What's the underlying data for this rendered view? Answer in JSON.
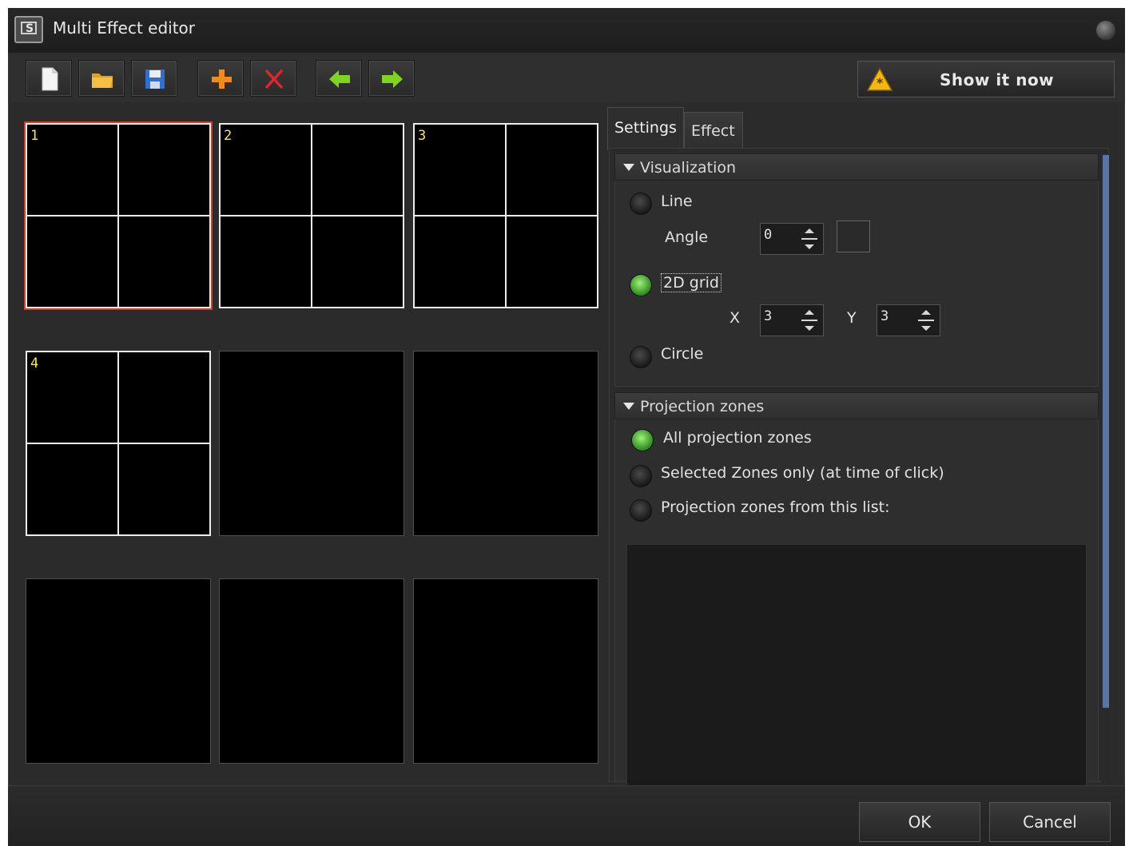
{
  "window": {
    "title": "Multi Effect editor"
  },
  "toolbar": {
    "buttons": [
      {
        "name": "new-file-button",
        "icon": "document-icon"
      },
      {
        "name": "open-folder-button",
        "icon": "folder-icon"
      },
      {
        "name": "save-button",
        "icon": "floppy-disk-icon"
      },
      {
        "name": "add-button",
        "icon": "plus-icon"
      },
      {
        "name": "delete-button",
        "icon": "x-icon"
      },
      {
        "name": "move-left-button",
        "icon": "arrow-left-icon"
      },
      {
        "name": "move-right-button",
        "icon": "arrow-right-icon"
      }
    ],
    "show_label": "Show it now"
  },
  "preview": {
    "cells": [
      {
        "label": "1",
        "grid": true,
        "selected": true
      },
      {
        "label": "2",
        "grid": true,
        "selected": false
      },
      {
        "label": "3",
        "grid": true,
        "selected": false
      },
      {
        "label": "4",
        "grid": true,
        "selected": false
      },
      {
        "label": "",
        "grid": false,
        "selected": false
      },
      {
        "label": "",
        "grid": false,
        "selected": false
      },
      {
        "label": "",
        "grid": false,
        "selected": false
      },
      {
        "label": "",
        "grid": false,
        "selected": false
      },
      {
        "label": "",
        "grid": false,
        "selected": false
      }
    ]
  },
  "tabs": {
    "settings": "Settings",
    "effect": "Effect",
    "active": "settings"
  },
  "visualization": {
    "header": "Visualization",
    "line_label": "Line",
    "angle_label": "Angle",
    "angle_value": "0",
    "grid_label": "2D grid",
    "x_label": "X",
    "x_value": "3",
    "y_label": "Y",
    "y_value": "3",
    "circle_label": "Circle",
    "selected": "2d-grid"
  },
  "projection": {
    "header": "Projection zones",
    "all_label": "All projection zones",
    "selected_label": "Selected Zones only (at time of click)",
    "list_label": "Projection zones from this list:",
    "selected": "all"
  },
  "footer": {
    "ok": "OK",
    "cancel": "Cancel"
  },
  "colors": {
    "selection_border": "#d83a2a",
    "cell_number": "#ffea3a",
    "radio_on": "#3fa52a",
    "scroll_thumb": "#5b74a8"
  }
}
